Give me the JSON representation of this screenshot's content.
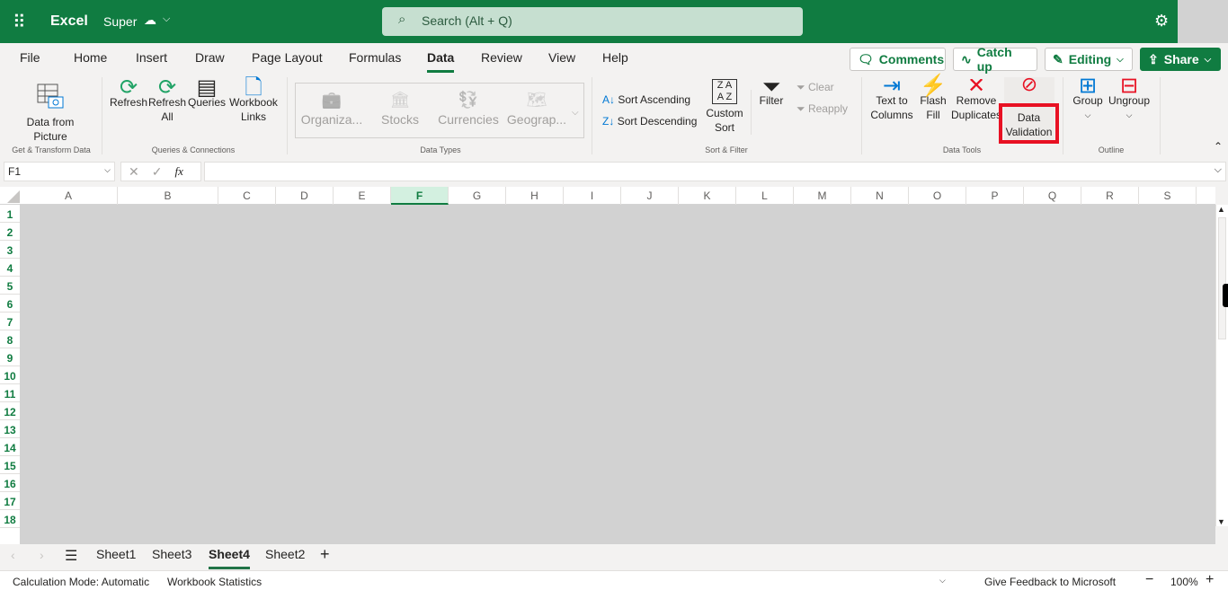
{
  "header": {
    "app_name": "Excel",
    "doc_name": "Super",
    "search_placeholder": "Search (Alt + Q)",
    "brand_color": "#107c41"
  },
  "tabs": [
    {
      "label": "File"
    },
    {
      "label": "Home"
    },
    {
      "label": "Insert"
    },
    {
      "label": "Draw"
    },
    {
      "label": "Page Layout"
    },
    {
      "label": "Formulas"
    },
    {
      "label": "Data",
      "active": true
    },
    {
      "label": "Review"
    },
    {
      "label": "View"
    },
    {
      "label": "Help"
    }
  ],
  "actions": {
    "comments": "Comments",
    "catch_up": "Catch up",
    "editing": "Editing",
    "share": "Share"
  },
  "ribbon": {
    "get_transform": {
      "data_from_picture": "Data from Picture",
      "group": "Get & Transform Data"
    },
    "queries": {
      "refresh": "Refresh",
      "refresh_all": "Refresh All",
      "queries": "Queries",
      "workbook_links": "Workbook Links",
      "group": "Queries & Connections"
    },
    "data_types": {
      "items": [
        "Organiza...",
        "Stocks",
        "Currencies",
        "Geograp..."
      ],
      "group": "Data Types"
    },
    "sort_filter": {
      "sort_asc": "Sort Ascending",
      "sort_desc": "Sort Descending",
      "custom_sort": "Custom Sort",
      "filter": "Filter",
      "clear": "Clear",
      "reapply": "Reapply",
      "group": "Sort & Filter"
    },
    "data_tools": {
      "text_to_columns": "Text to Columns",
      "flash_fill": "Flash Fill",
      "remove_duplicates": "Remove Duplicates",
      "data_validation": "Data Validation",
      "group": "Data Tools"
    },
    "outline": {
      "group_btn": "Group",
      "ungroup": "Ungroup",
      "group": "Outline"
    }
  },
  "formula_bar": {
    "name_box": "F1",
    "fx": "fx",
    "value": ""
  },
  "grid": {
    "columns": [
      "A",
      "B",
      "C",
      "D",
      "E",
      "F",
      "G",
      "H",
      "I",
      "J",
      "K",
      "L",
      "M",
      "N",
      "O",
      "P",
      "Q",
      "R",
      "S"
    ],
    "selected_column": "F",
    "rows": [
      "1",
      "2",
      "3",
      "4",
      "5",
      "6",
      "7",
      "8",
      "9",
      "10",
      "11",
      "12",
      "13",
      "14",
      "15",
      "16",
      "17",
      "18"
    ]
  },
  "sheets": [
    {
      "label": "Sheet1"
    },
    {
      "label": "Sheet3"
    },
    {
      "label": "Sheet4",
      "active": true
    },
    {
      "label": "Sheet2"
    }
  ],
  "status": {
    "calc_mode": "Calculation Mode: Automatic",
    "workbook_stats": "Workbook Statistics",
    "feedback": "Give Feedback to Microsoft",
    "zoom": "100%"
  },
  "highlight_color": "#e81123"
}
